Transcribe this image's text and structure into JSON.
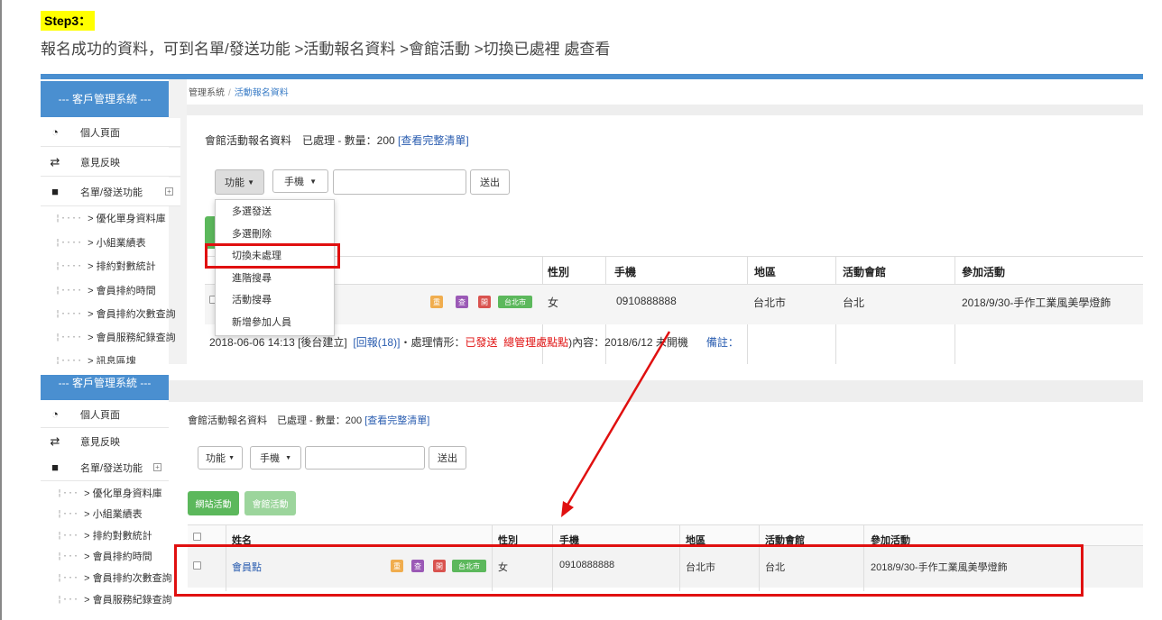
{
  "header": {
    "step": "Step3：",
    "description": "報名成功的資料，可到名單/發送功能 >活動報名資料 >會館活動 >切換已處裡 處查看"
  },
  "sidebar": {
    "title": "--- 客戶管理系統 ---",
    "items": [
      {
        "label": "個人頁面",
        "icon": "dashboard-icon"
      },
      {
        "label": "意見反映",
        "icon": "swap-icon"
      },
      {
        "label": "名單/發送功能",
        "icon": "folder-icon"
      }
    ],
    "sub_items": [
      "> 優化單身資料庫",
      "> 小組業績表",
      "> 排約對數統計",
      "> 會員排約時間",
      "> 會員排約次數查詢",
      "> 會員服務紀錄查詢",
      "> 訊息區塊"
    ]
  },
  "breadcrumb": {
    "root": "管理系統",
    "separator": "/",
    "current": "活動報名資料"
  },
  "panel_title": {
    "text": "會館活動報名資料　已處理 - 數量：200",
    "link": "[查看完整清單]"
  },
  "toolbar": {
    "func_label": "功能",
    "select_value": "手機",
    "submit_label": "送出"
  },
  "func_menu": [
    "多選發送",
    "多選刪除",
    "切換未處理",
    "進階搜尋",
    "活動搜尋",
    "新增參加人員"
  ],
  "action_buttons": {
    "primary": "網站活動",
    "secondary": "會館活動"
  },
  "table": {
    "columns": [
      "姓名",
      "性別",
      "手機",
      "地區",
      "活動會館",
      "參加活動"
    ],
    "row": {
      "name": "會員點",
      "tags": [
        "重",
        "查",
        "開"
      ],
      "tag_location": "台北市",
      "gender": "女",
      "phone": "0910888888",
      "region": "台北市",
      "branch": "台北",
      "event": "2018/9/30-手作工業風美學燈飾"
    },
    "detail": {
      "prefix": "2018-06-06 14:13 [後台建立]",
      "reply": "[回報(18)]",
      "status_label": "・處理情形：",
      "status_sent": "已發送",
      "status_admin": "總管理處點點",
      "content": ")內容：2018/6/12 未開機",
      "note": "備註："
    }
  },
  "colors": {
    "accent": "#4a8fd0",
    "highlight": "#e01010",
    "tag_orange": "#f0ad4e",
    "tag_purple": "#9b59b6",
    "tag_red": "#d9534f",
    "tag_green": "#5cb85c"
  }
}
